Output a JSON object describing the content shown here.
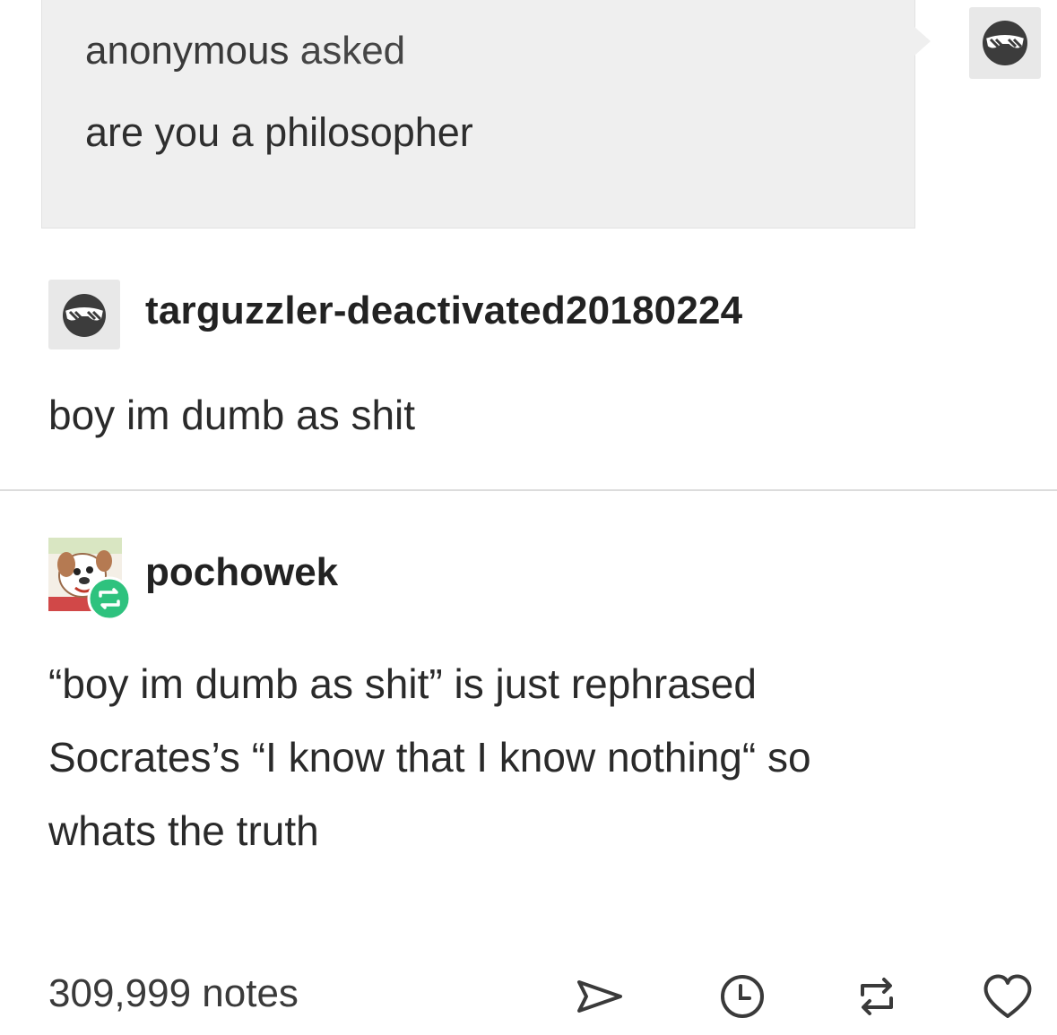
{
  "ask": {
    "asker": "anonymous",
    "verb": "asked",
    "question": "are you a philosopher"
  },
  "post1": {
    "username": "targuzzler-deactivated20180224",
    "text": "boy im dumb as shit"
  },
  "post2": {
    "username": "pochowek",
    "lines": [
      "“boy im dumb as shit” is just rephrased",
      "Socrates’s “I know that I know nothing“ so",
      "whats the truth"
    ]
  },
  "footer": {
    "notes": "309,999 notes",
    "icons": [
      "share-icon",
      "history-icon",
      "reblog-icon",
      "like-icon"
    ]
  },
  "colors": {
    "ask_bg": "#efefef",
    "reblog_badge": "#2ec27e",
    "text": "#2b2b2b"
  }
}
